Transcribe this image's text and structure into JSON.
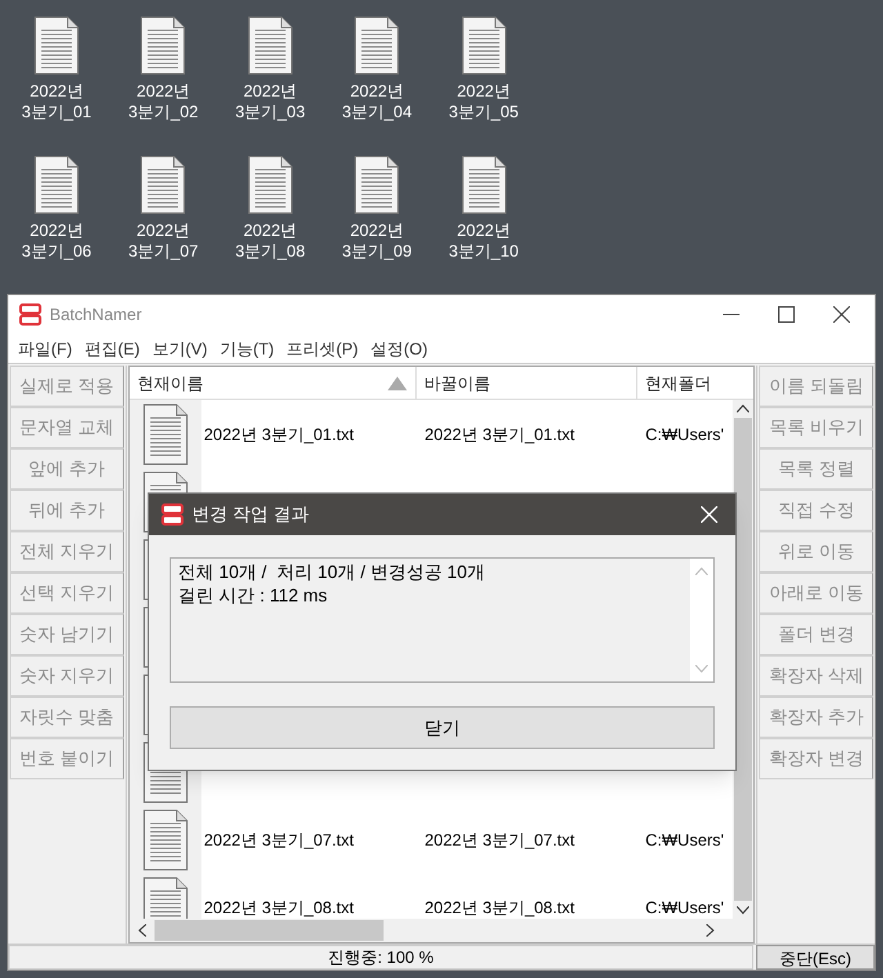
{
  "desktop_icons": [
    {
      "label": "2022년\n3분기_01"
    },
    {
      "label": "2022년\n3분기_02"
    },
    {
      "label": "2022년\n3분기_03"
    },
    {
      "label": "2022년\n3분기_04"
    },
    {
      "label": "2022년\n3분기_05"
    },
    {
      "label": "2022년\n3분기_06"
    },
    {
      "label": "2022년\n3분기_07"
    },
    {
      "label": "2022년\n3분기_08"
    },
    {
      "label": "2022년\n3분기_09"
    },
    {
      "label": "2022년\n3분기_10"
    }
  ],
  "window": {
    "title": "BatchNamer"
  },
  "menu": [
    "파일(F)",
    "편집(E)",
    "보기(V)",
    "기능(T)",
    "프리셋(P)",
    "설정(O)"
  ],
  "left_buttons": [
    "실제로 적용",
    "문자열 교체",
    "앞에 추가",
    "뒤에 추가",
    "전체 지우기",
    "선택 지우기",
    "숫자 남기기",
    "숫자 지우기",
    "자릿수 맞춤",
    "번호 붙이기"
  ],
  "right_buttons": [
    "이름 되돌림",
    "목록 비우기",
    "목록 정렬",
    "직접 수정",
    "위로 이동",
    "아래로 이동",
    "폴더 변경",
    "확장자 삭제",
    "확장자 추가",
    "확장자 변경"
  ],
  "table": {
    "columns": [
      "현재이름",
      "바꿀이름",
      "현재폴더"
    ],
    "rows": [
      {
        "kind": "file",
        "name": "2022년 3분기_01.txt",
        "new_name": "2022년 3분기_01.txt",
        "folder": "C:₩Users'"
      },
      {
        "kind": "covered"
      },
      {
        "kind": "covered"
      },
      {
        "kind": "covered"
      },
      {
        "kind": "covered"
      },
      {
        "kind": "covered"
      },
      {
        "kind": "file",
        "name": "2022년 3분기_07.txt",
        "new_name": "2022년 3분기_07.txt",
        "folder": "C:₩Users'"
      },
      {
        "kind": "file",
        "name": "2022년 3분기_08.txt",
        "new_name": "2022년 3분기_08.txt",
        "folder": "C:₩Users'"
      }
    ]
  },
  "status_bar": {
    "progress": "진행중: 100 %",
    "stop_button": "중단(Esc)"
  },
  "dialog": {
    "title": "변경 작업 결과",
    "lines": [
      "전체 10개 /  처리 10개 / 변경성공 10개",
      "걸린 시간 : 112 ms"
    ],
    "close_button": "닫기"
  }
}
